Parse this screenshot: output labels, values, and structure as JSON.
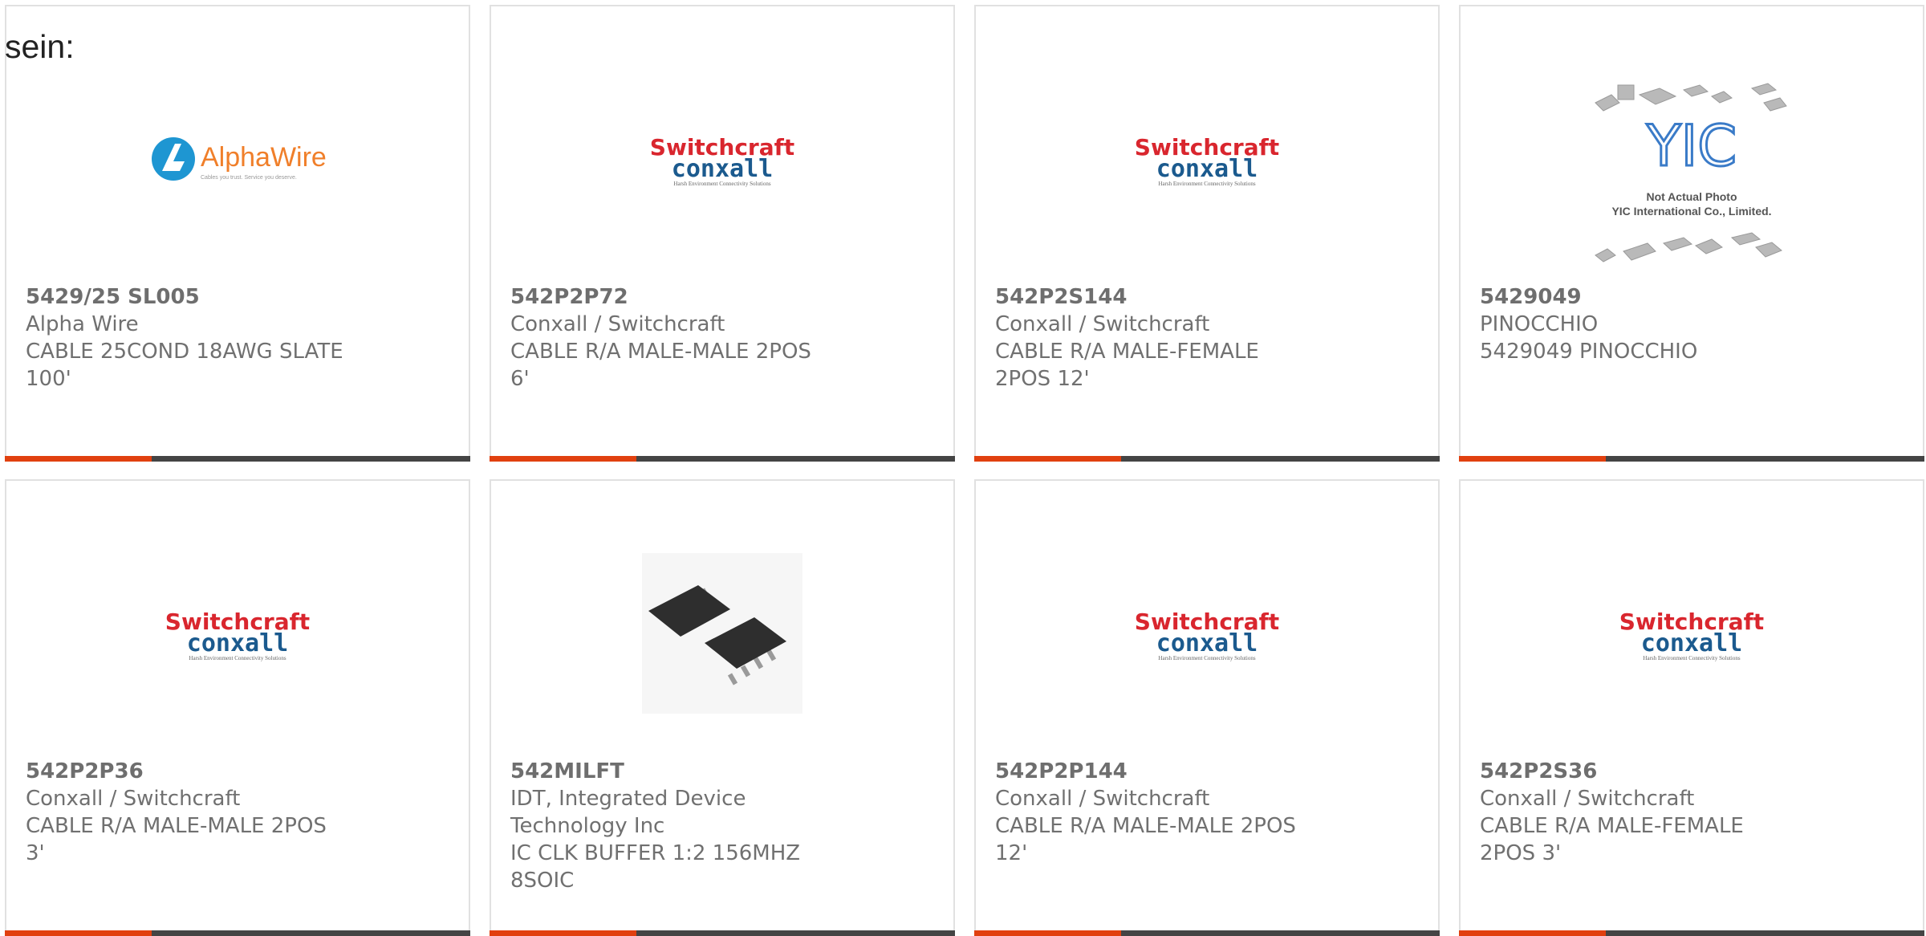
{
  "lead_text": "sein:",
  "products": [
    {
      "part_number": "5429/25 SL005",
      "manufacturer": "Alpha Wire",
      "description": "CABLE 25COND 18AWG SLATE 100'",
      "image": "alphawire-logo"
    },
    {
      "part_number": "542P2P72",
      "manufacturer": "Conxall / Switchcraft",
      "description": "CABLE R/A MALE-MALE 2POS 6'",
      "image": "switchcraft-conxall-logo"
    },
    {
      "part_number": "542P2S144",
      "manufacturer": "Conxall / Switchcraft",
      "description": "CABLE R/A MALE-FEMALE 2POS 12'",
      "image": "switchcraft-conxall-logo"
    },
    {
      "part_number": "5429049",
      "manufacturer": "PINOCCHIO",
      "description": "5429049 PINOCCHIO",
      "image": "yic-not-actual-photo"
    },
    {
      "part_number": "542P2P36",
      "manufacturer": "Conxall / Switchcraft",
      "description": "CABLE R/A MALE-MALE 2POS 3'",
      "image": "switchcraft-conxall-logo"
    },
    {
      "part_number": "542MILFT",
      "manufacturer": "IDT, Integrated Device Technology Inc",
      "description": "IC CLK BUFFER 1:2 156MHZ 8SOIC",
      "image": "soic-chip-photo"
    },
    {
      "part_number": "542P2P144",
      "manufacturer": "Conxall / Switchcraft",
      "description": "CABLE R/A MALE-MALE 2POS 12'",
      "image": "switchcraft-conxall-logo"
    },
    {
      "part_number": "542P2S36",
      "manufacturer": "Conxall / Switchcraft",
      "description": "CABLE R/A MALE-FEMALE 2POS 3'",
      "image": "switchcraft-conxall-logo"
    }
  ],
  "logos": {
    "alphawire": {
      "name": "AlphaWire",
      "tagline": "Cables you trust. Service you deserve."
    },
    "switchcraft": {
      "line1": "Switchcraft",
      "line2": "conxall",
      "tagline": "Harsh Environment Connectivity Solutions"
    },
    "yic": {
      "mark": "YIC",
      "line1": "Not Actual Photo",
      "line2": "YIC International Co., Limited."
    }
  },
  "colors": {
    "accent": "#e1400f",
    "bar": "#444444",
    "switchcraft_red": "#d9262e",
    "conxall_blue": "#1b5a8e",
    "alpha_blue": "#1e96d2",
    "alpha_orange": "#f07f2a"
  }
}
